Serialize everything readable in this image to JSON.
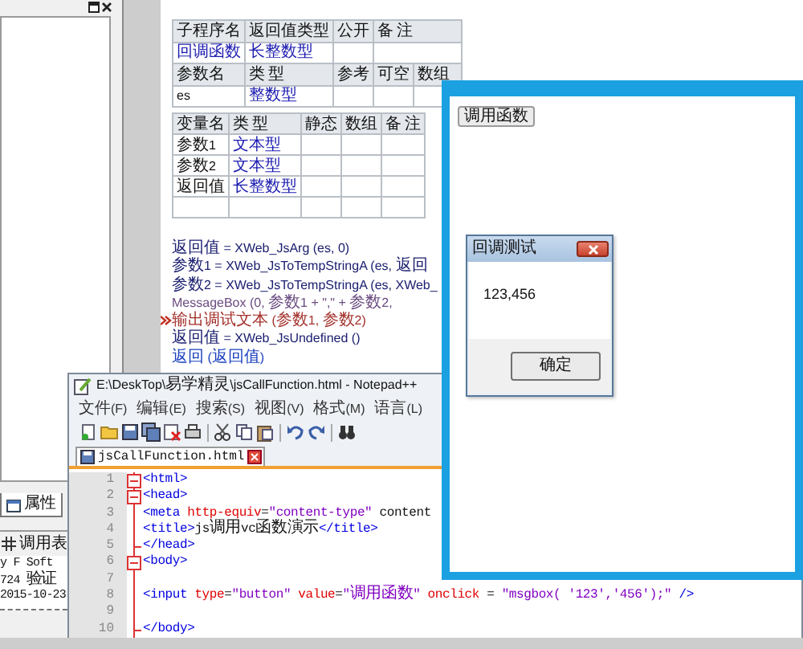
{
  "side_panel": {
    "tab": "属性",
    "call_table_tab": "调用表",
    "info_lines": [
      "y F Soft",
      "724 验证",
      "2015-10-23"
    ]
  },
  "subroutine_table": {
    "columns": [
      "子程序名",
      "返回值类型",
      "公开",
      "备 注"
    ],
    "row": {
      "name": "回调函数",
      "return_type": "长整数型"
    },
    "param_columns": [
      "参数名",
      "类 型",
      "参考",
      "可空",
      "数组"
    ],
    "params": [
      {
        "name": "es",
        "type": "整数型"
      }
    ]
  },
  "variable_table": {
    "columns": [
      "变量名",
      "类 型",
      "静态",
      "数组",
      "备 注"
    ],
    "rows": [
      {
        "name": "参数1",
        "type": "文本型"
      },
      {
        "name": "参数2",
        "type": "文本型"
      },
      {
        "name": "返回值",
        "type": "长整数型"
      }
    ]
  },
  "code_lines": [
    {
      "kind": "statement",
      "text": "返回值 = XWeb_JsArg (es, 0)",
      "marker": false
    },
    {
      "kind": "statement",
      "text": "参数1 = XWeb_JsToTempStringA (es, 返回",
      "marker": false
    },
    {
      "kind": "statement",
      "text": "参数2 = XWeb_JsToTempStringA (es, XWeb_",
      "marker": false
    },
    {
      "kind": "call",
      "text": "MessageBox (0, 参数1 + \",\" + 参数2,",
      "marker": false
    },
    {
      "kind": "debug",
      "text": "输出调试文本 (参数1, 参数2)",
      "marker": true
    },
    {
      "kind": "statement",
      "text": "返回值 = XWeb_JsUndefined ()",
      "marker": false
    },
    {
      "kind": "return",
      "text": "返回 (返回值)",
      "marker": false
    }
  ],
  "notepad": {
    "title": "E:\\DeskTop\\易学精灵\\jsCallFunction.html - Notepad++",
    "menu": [
      "文件(F)",
      "编辑(E)",
      "搜索(S)",
      "视图(V)",
      "格式(M)",
      "语言(L)"
    ],
    "tab": "jsCallFunction.html",
    "lines": [
      {
        "number": "1",
        "text": "<html>",
        "fold_open": true,
        "fold_end": false
      },
      {
        "number": "2",
        "text": "<head>",
        "fold_open": true,
        "fold_end": false
      },
      {
        "number": "3",
        "text": "<meta http-equiv=\"content-type\" content",
        "fold_open": false,
        "fold_end": false
      },
      {
        "number": "4",
        "text": "<title>js调用vc函数演示</title>",
        "fold_open": false,
        "fold_end": false
      },
      {
        "number": "5",
        "text": "</head>",
        "fold_open": false,
        "fold_end": true
      },
      {
        "number": "6",
        "text": "<body>",
        "fold_open": true,
        "fold_end": false
      },
      {
        "number": "7",
        "fold_open": false,
        "fold_end": false
      },
      {
        "number": "8",
        "text": "<input type=\"button\" value=\"调用函数\" onclick = \"msgbox( '123','456');\" />",
        "fold_open": false,
        "fold_end": false
      },
      {
        "number": "9",
        "fold_open": false,
        "fold_end": false
      },
      {
        "number": "10",
        "text": "</body>",
        "fold_open": false,
        "fold_end": true
      }
    ]
  },
  "browser": {
    "button": "调用函数"
  },
  "dialog": {
    "title": "回调测试",
    "message": "123,456",
    "ok": "确定"
  }
}
